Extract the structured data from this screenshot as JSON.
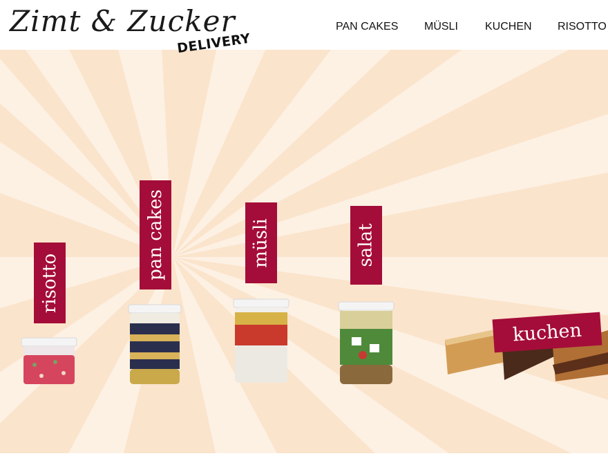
{
  "brand": {
    "logo_text": "Zimt & Zucker",
    "badge": "DELIVERY"
  },
  "nav": {
    "items": [
      {
        "label": "PAN CAKES"
      },
      {
        "label": "MÜSLI"
      },
      {
        "label": "KUCHEN"
      },
      {
        "label": "RISOTTO"
      }
    ]
  },
  "products": [
    {
      "label": "risotto"
    },
    {
      "label": "pan cakes"
    },
    {
      "label": "müsli"
    },
    {
      "label": "salat"
    },
    {
      "label": "kuchen"
    }
  ],
  "colors": {
    "accent": "#a40d39",
    "background": "#fbe4cc",
    "rays": "#fdf1e4",
    "header": "#ffffff"
  }
}
